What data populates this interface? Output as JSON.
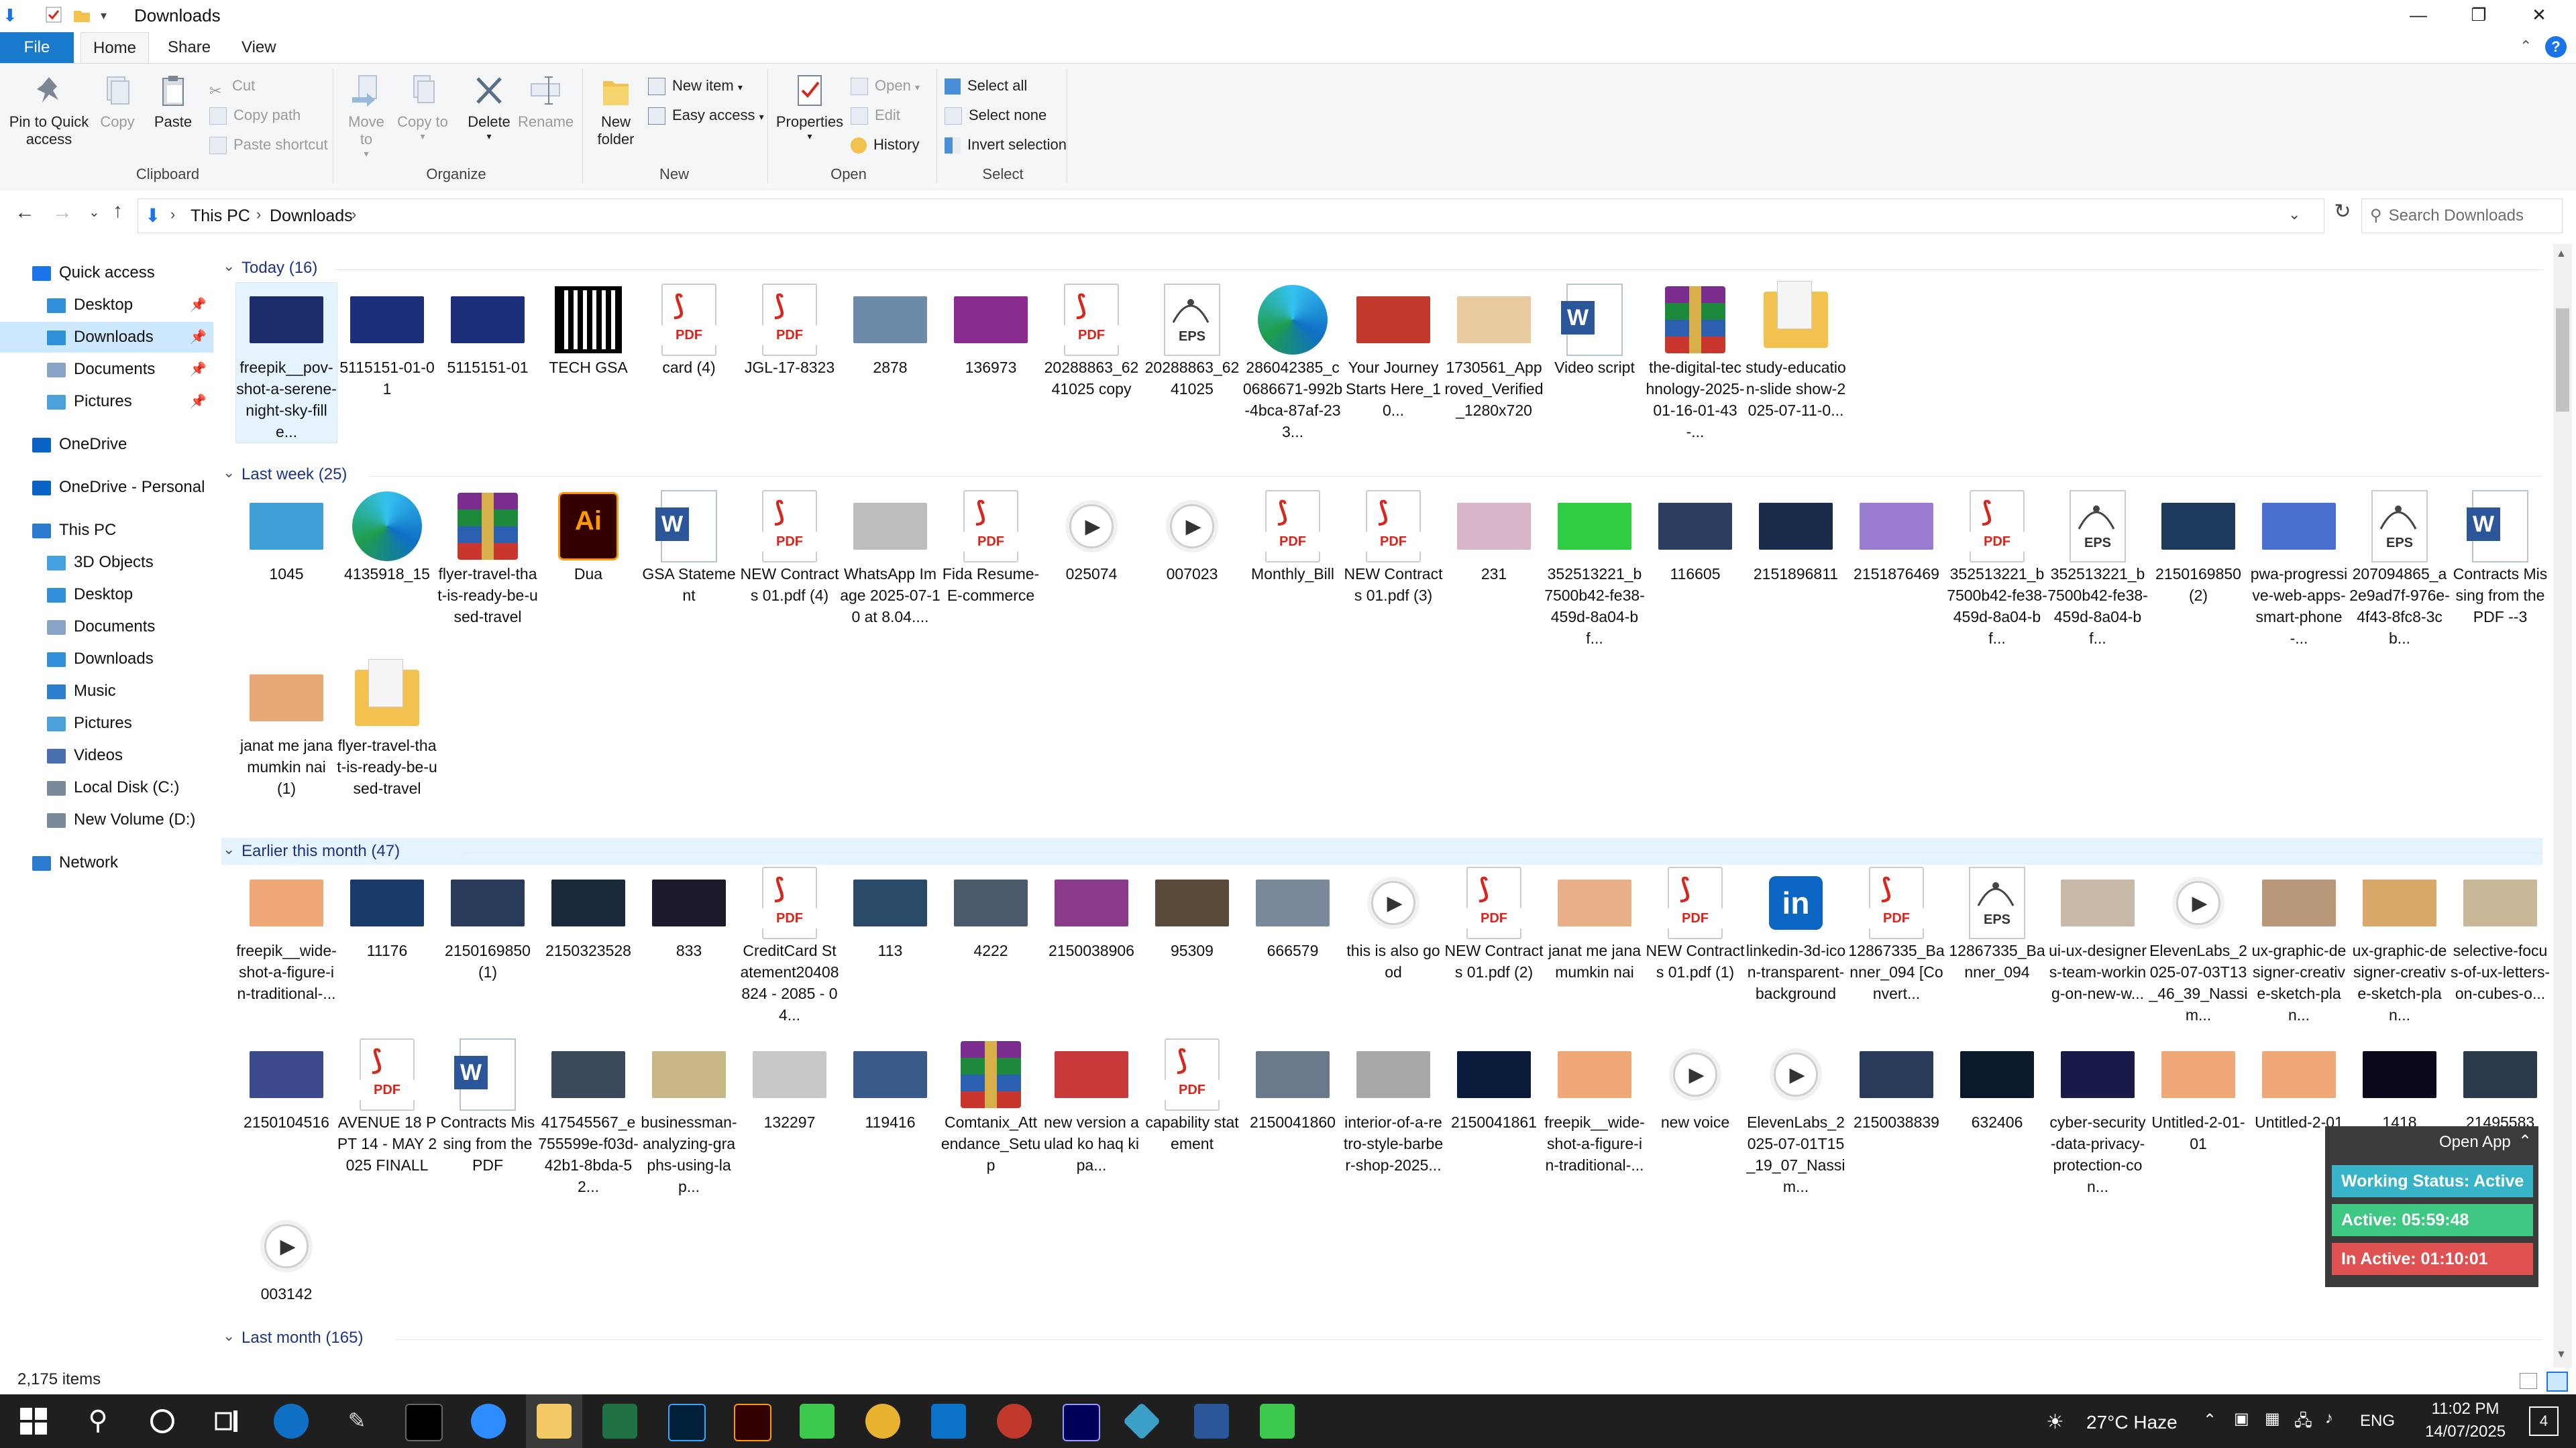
{
  "window": {
    "title": "Downloads",
    "controls": [
      "—",
      "❐",
      "✕"
    ]
  },
  "ribbon_tabs": [
    "File",
    "Home",
    "Share",
    "View"
  ],
  "ribbon": {
    "clipboard": {
      "pin": "Pin to Quick access",
      "copy": "Copy",
      "paste": "Paste",
      "cut": "Cut",
      "copy_path": "Copy path",
      "paste_shortcut": "Paste shortcut",
      "label": "Clipboard"
    },
    "organize": {
      "move_to": "Move to",
      "copy_to": "Copy to",
      "delete": "Delete",
      "rename": "Rename",
      "label": "Organize"
    },
    "new": {
      "new_folder": "New folder",
      "new_item": "New item",
      "easy_access": "Easy access",
      "label": "New"
    },
    "open": {
      "properties": "Properties",
      "open": "Open",
      "edit": "Edit",
      "history": "History",
      "label": "Open"
    },
    "select": {
      "select_all": "Select all",
      "select_none": "Select none",
      "invert": "Invert selection",
      "label": "Select"
    }
  },
  "address": {
    "crumbs": [
      "This PC",
      "Downloads"
    ],
    "search_placeholder": "Search Downloads"
  },
  "nav": [
    {
      "label": "Quick access",
      "color": "#1a73e8",
      "level": 0
    },
    {
      "label": "Desktop",
      "color": "#2f8fd8",
      "level": 1,
      "pin": true
    },
    {
      "label": "Downloads",
      "color": "#2f8fd8",
      "level": 1,
      "pin": true,
      "selected": true
    },
    {
      "label": "Documents",
      "color": "#8aa4c8",
      "level": 1,
      "pin": true
    },
    {
      "label": "Pictures",
      "color": "#4aa0d8",
      "level": 1,
      "pin": true
    },
    {
      "label": "OneDrive",
      "color": "#0a64c8",
      "level": 0
    },
    {
      "label": "OneDrive - Personal",
      "color": "#0a64c8",
      "level": 0
    },
    {
      "label": "This PC",
      "color": "#2a7ad0",
      "level": 0
    },
    {
      "label": "3D Objects",
      "color": "#45a0e0",
      "level": 1
    },
    {
      "label": "Desktop",
      "color": "#2f8fd8",
      "level": 1
    },
    {
      "label": "Documents",
      "color": "#8aa4c8",
      "level": 1
    },
    {
      "label": "Downloads",
      "color": "#2f8fd8",
      "level": 1
    },
    {
      "label": "Music",
      "color": "#2f7fd0",
      "level": 1
    },
    {
      "label": "Pictures",
      "color": "#4aa0d8",
      "level": 1
    },
    {
      "label": "Videos",
      "color": "#4a6fb0",
      "level": 1
    },
    {
      "label": "Local Disk (C:)",
      "color": "#7a8a9a",
      "level": 1
    },
    {
      "label": "New Volume (D:)",
      "color": "#7a8a9a",
      "level": 1
    },
    {
      "label": "Network",
      "color": "#2a7ad0",
      "level": 0
    }
  ],
  "groups": [
    {
      "label": "Today (16)"
    },
    {
      "label": "Last week (25)"
    },
    {
      "label": "Earlier this month (47)"
    },
    {
      "label": "Last month (165)"
    }
  ],
  "today": [
    {
      "label": "freepik__pov-shot-a-serene-night-sky-fille...",
      "kind": "photo",
      "color": "#1b2d6b"
    },
    {
      "label": "5115151-01-01",
      "kind": "photo",
      "color": "#1c2e7a"
    },
    {
      "label": "5115151-01",
      "kind": "photo",
      "color": "#1c2e7a"
    },
    {
      "label": "TECH GSA",
      "kind": "qr"
    },
    {
      "label": "card (4)",
      "kind": "pdf"
    },
    {
      "label": "JGL-17-8323",
      "kind": "pdf"
    },
    {
      "label": "2878",
      "kind": "photo",
      "color": "#6d8aa8"
    },
    {
      "label": "136973",
      "kind": "photo",
      "color": "#8a2b8f"
    },
    {
      "label": "20288863_6241025 copy",
      "kind": "pdf"
    },
    {
      "label": "20288863_6241025",
      "kind": "eps"
    },
    {
      "label": "286042385_c0686671-992b-4bca-87af-233...",
      "kind": "edge"
    },
    {
      "label": "Your Journey Starts Here_10...",
      "kind": "photo",
      "color": "#c0392b"
    },
    {
      "label": "1730561_Approved_Verified_1280x720",
      "kind": "photo",
      "color": "#e8c9a0"
    },
    {
      "label": "Video script",
      "kind": "word"
    },
    {
      "label": "the-digital-technology-2025-01-16-01-43-...",
      "kind": "rar"
    },
    {
      "label": "study-education-slide show-2025-07-11-0...",
      "kind": "folder"
    }
  ],
  "lastweek": [
    {
      "label": "1045",
      "kind": "photo",
      "color": "#3fa0d8"
    },
    {
      "label": "4135918_15",
      "kind": "edge"
    },
    {
      "label": "flyer-travel-that-is-ready-be-used-travel",
      "kind": "rar"
    },
    {
      "label": "Dua",
      "kind": "ai"
    },
    {
      "label": "GSA Statement",
      "kind": "word"
    },
    {
      "label": "NEW Contracts 01.pdf (4)",
      "kind": "pdf"
    },
    {
      "label": "WhatsApp Image 2025-07-10 at 8.04....",
      "kind": "photo",
      "color": "#bdbdbd"
    },
    {
      "label": "Fida Resume-E-commerce",
      "kind": "pdf"
    },
    {
      "label": "025074",
      "kind": "play"
    },
    {
      "label": "007023",
      "kind": "play"
    },
    {
      "label": "Monthly_Bill",
      "kind": "pdf"
    },
    {
      "label": "NEW Contracts 01.pdf (3)",
      "kind": "pdf"
    },
    {
      "label": "231",
      "kind": "photo",
      "color": "#d8b4c8"
    },
    {
      "label": "352513221_b7500b42-fe38-459d-8a04-bf...",
      "kind": "photo",
      "color": "#2ecc40"
    },
    {
      "label": "116605",
      "kind": "photo",
      "color": "#2c3e60"
    },
    {
      "label": "2151896811",
      "kind": "photo",
      "color": "#1a2a4a"
    },
    {
      "label": "2151876469",
      "kind": "photo",
      "color": "#9b7bd0"
    },
    {
      "label": "352513221_b7500b42-fe38-459d-8a04-bf...",
      "kind": "pdf"
    },
    {
      "label": "352513221_b7500b42-fe38-459d-8a04-bf...",
      "kind": "eps"
    },
    {
      "label": "2150169850 (2)",
      "kind": "photo",
      "color": "#1d3a5c"
    },
    {
      "label": "pwa-progressive-web-apps-smart-phone-...",
      "kind": "photo",
      "color": "#4a6fd0"
    },
    {
      "label": "207094865_a2e9ad7f-976e-4f43-8fc8-3cb...",
      "kind": "eps"
    },
    {
      "label": "Contracts Missing from the PDF --3",
      "kind": "word"
    },
    {
      "label": "janat me jana mumkin nai (1)",
      "kind": "photo",
      "color": "#e8a878"
    },
    {
      "label": "flyer-travel-that-is-ready-be-used-travel",
      "kind": "folder"
    }
  ],
  "earlier1": [
    {
      "label": "freepik__wide-shot-a-figure-in-traditional-...",
      "kind": "photo",
      "color": "#f0a878"
    },
    {
      "label": "11176",
      "kind": "photo",
      "color": "#1a3a6a"
    },
    {
      "label": "2150169850 (1)",
      "kind": "photo",
      "color": "#2a3a5a"
    },
    {
      "label": "2150323528",
      "kind": "photo",
      "color": "#1a2a3a"
    },
    {
      "label": "833",
      "kind": "photo",
      "color": "#1a1a2a"
    },
    {
      "label": "CreditCard Statement20408824 - 2085 - 04...",
      "kind": "pdf"
    },
    {
      "label": "113",
      "kind": "photo",
      "color": "#2a4a6a"
    },
    {
      "label": "4222",
      "kind": "photo",
      "color": "#4a5a6a"
    },
    {
      "label": "2150038906",
      "kind": "photo",
      "color": "#8a3a8a"
    },
    {
      "label": "95309",
      "kind": "photo",
      "color": "#5a4a3a"
    },
    {
      "label": "666579",
      "kind": "photo",
      "color": "#7a8a9a"
    },
    {
      "label": "this is also good",
      "kind": "play"
    },
    {
      "label": "NEW Contracts 01.pdf (2)",
      "kind": "pdf"
    },
    {
      "label": "janat me jana mumkin nai",
      "kind": "photo",
      "color": "#e8b088"
    },
    {
      "label": "NEW Contracts 01.pdf (1)",
      "kind": "pdf"
    },
    {
      "label": "linkedin-3d-icon-transparent-background",
      "kind": "linkedin"
    },
    {
      "label": "12867335_Banner_094 [Convert...",
      "kind": "pdf"
    },
    {
      "label": "12867335_Banner_094",
      "kind": "eps"
    },
    {
      "label": "ui-ux-designers-team-working-on-new-w...",
      "kind": "photo",
      "color": "#c8b8a8"
    },
    {
      "label": "ElevenLabs_2025-07-03T13_46_39_Nassim...",
      "kind": "play"
    },
    {
      "label": "ux-graphic-designer-creative-sketch-plan...",
      "kind": "photo",
      "color": "#b89878"
    },
    {
      "label": "ux-graphic-designer-creative-sketch-plan...",
      "kind": "photo",
      "color": "#d8a868"
    },
    {
      "label": "selective-focus-of-ux-letters-on-cubes-o...",
      "kind": "photo",
      "color": "#c8b898"
    }
  ],
  "earlier2": [
    {
      "label": "2150104516",
      "kind": "photo",
      "color": "#3a4a8a"
    },
    {
      "label": "AVENUE 18 PPT 14 - MAY 2025 FINALL",
      "kind": "pdf"
    },
    {
      "label": "Contracts Missing from the PDF",
      "kind": "word"
    },
    {
      "label": "417545567_e755599e-f03d-42b1-8bda-52...",
      "kind": "photo",
      "color": "#3a4a5a"
    },
    {
      "label": "businessman-analyzing-graphs-using-lap...",
      "kind": "photo",
      "color": "#c8b888"
    },
    {
      "label": "132297",
      "kind": "photo",
      "color": "#c8c8c8"
    },
    {
      "label": "119416",
      "kind": "photo",
      "color": "#3a5a8a"
    },
    {
      "label": "Comtanix_Attendance_Setup",
      "kind": "rar"
    },
    {
      "label": "new version aulad ko haq ki pa...",
      "kind": "photo",
      "color": "#c83a3a"
    },
    {
      "label": "capability statement",
      "kind": "pdf"
    },
    {
      "label": "2150041860",
      "kind": "photo",
      "color": "#6a7a8a"
    },
    {
      "label": "interior-of-a-retro-style-barber-shop-2025...",
      "kind": "photo",
      "color": "#a8a8a8"
    },
    {
      "label": "2150041861",
      "kind": "photo",
      "color": "#0a1a3a"
    },
    {
      "label": "freepik__wide-shot-a-figure-in-traditional-...",
      "kind": "photo",
      "color": "#f0a878"
    },
    {
      "label": "new voice",
      "kind": "play"
    },
    {
      "label": "ElevenLabs_2025-07-01T15_19_07_Nassim...",
      "kind": "play"
    },
    {
      "label": "2150038839",
      "kind": "photo",
      "color": "#2a3a5a"
    },
    {
      "label": "632406",
      "kind": "photo",
      "color": "#0a1a2a"
    },
    {
      "label": "cyber-security-data-privacy-protection-con...",
      "kind": "photo",
      "color": "#1a1a4a"
    },
    {
      "label": "Untitled-2-01-01",
      "kind": "photo",
      "color": "#f0a878"
    },
    {
      "label": "Untitled-2-01",
      "kind": "photo",
      "color": "#f0a878"
    },
    {
      "label": "1418",
      "kind": "photo",
      "color": "#0a0a1a"
    },
    {
      "label": "21495583",
      "kind": "photo",
      "color": "#2a3a4a"
    }
  ],
  "earlier3": [
    {
      "label": "003142",
      "kind": "play"
    }
  ],
  "status": {
    "count": "2,175 items"
  },
  "widget": {
    "open_app": "Open App",
    "working": "Working Status: Active",
    "active": "Active: 05:59:48",
    "inactive": "In Active: 01:10:01"
  },
  "taskbar": {
    "weather": "27°C Haze",
    "lang": "ENG",
    "time": "11:02 PM",
    "date": "14/07/2025",
    "notif": "4"
  }
}
